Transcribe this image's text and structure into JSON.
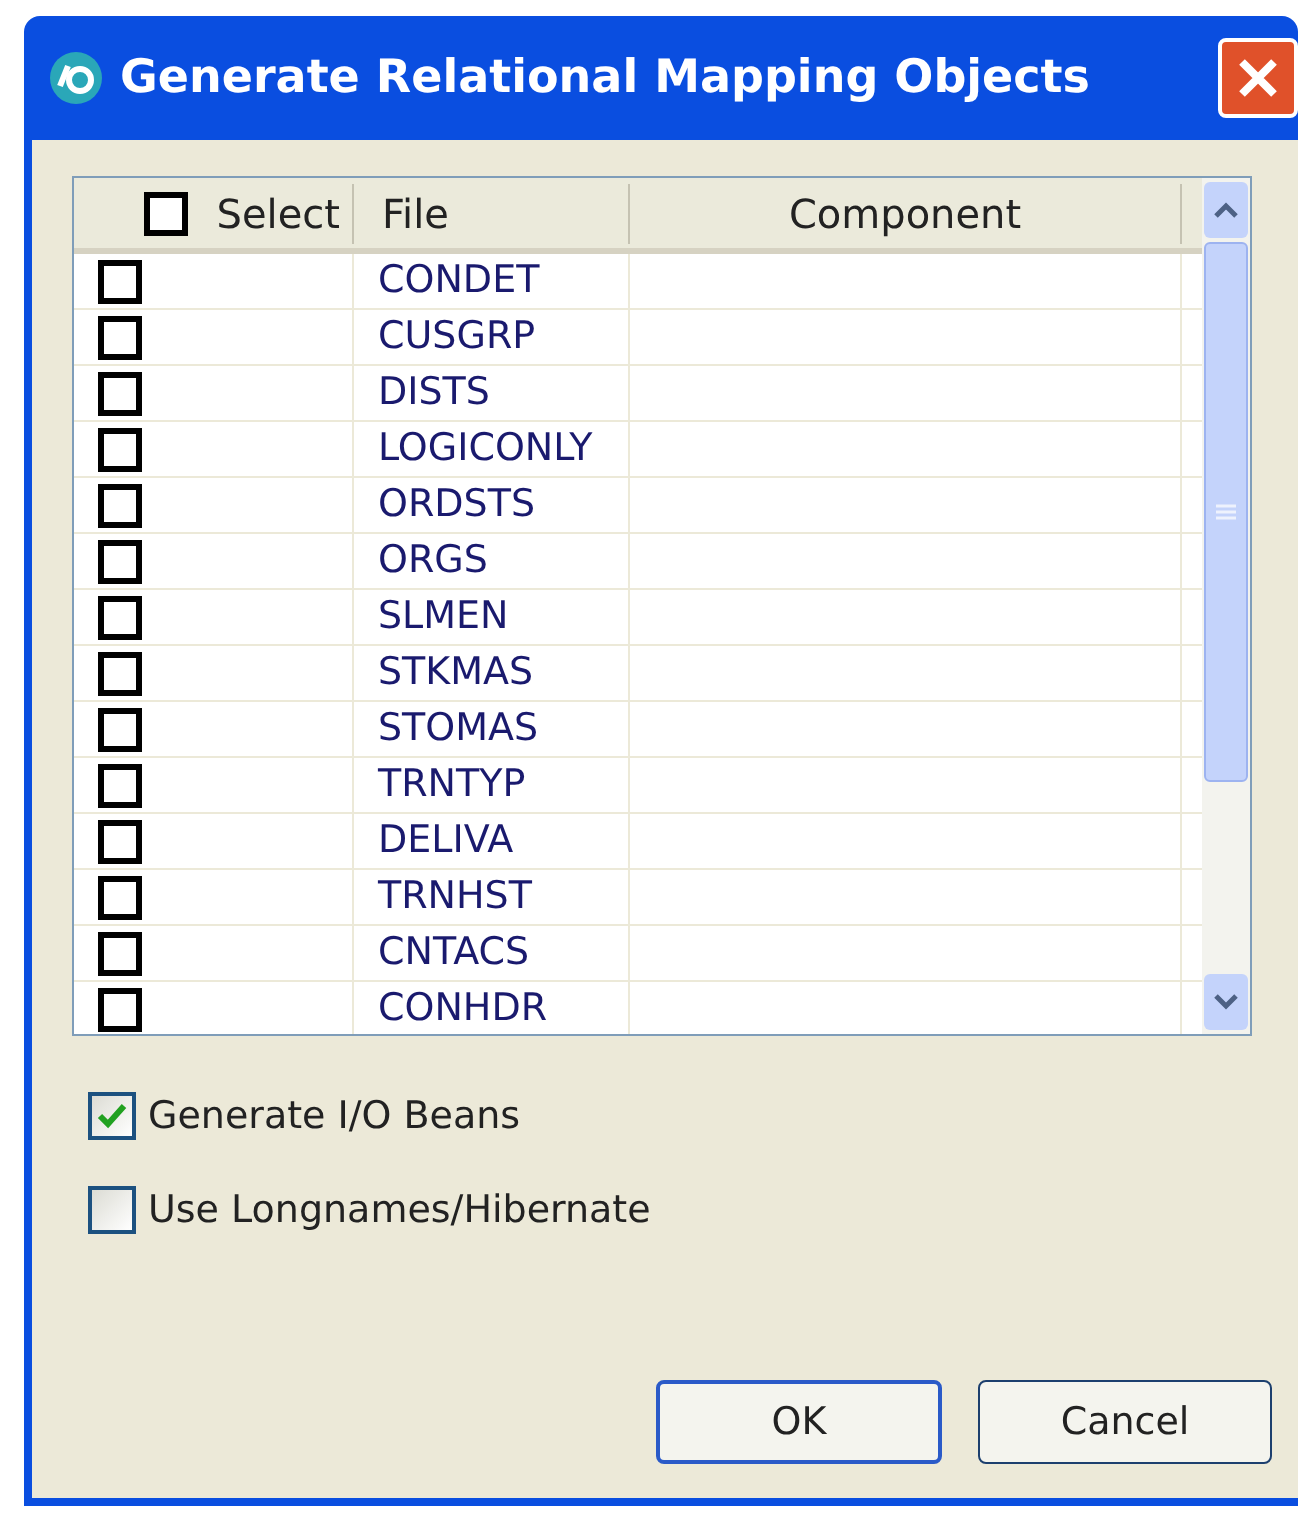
{
  "window": {
    "title": "Generate Relational Mapping Objects"
  },
  "table": {
    "select_all": {
      "checked": false
    },
    "columns": [
      "Select",
      "File",
      "Component"
    ],
    "rows": [
      {
        "checked": false,
        "file": "CONDET"
      },
      {
        "checked": false,
        "file": "CUSGRP"
      },
      {
        "checked": false,
        "file": "DISTS"
      },
      {
        "checked": false,
        "file": "LOGICONLY"
      },
      {
        "checked": false,
        "file": "ORDSTS"
      },
      {
        "checked": false,
        "file": "ORGS"
      },
      {
        "checked": false,
        "file": "SLMEN"
      },
      {
        "checked": false,
        "file": "STKMAS"
      },
      {
        "checked": false,
        "file": "STOMAS"
      },
      {
        "checked": false,
        "file": "TRNTYP"
      },
      {
        "checked": false,
        "file": "DELIVA"
      },
      {
        "checked": false,
        "file": "TRNHST"
      },
      {
        "checked": false,
        "file": "CNTACS"
      },
      {
        "checked": false,
        "file": "CONHDR"
      }
    ]
  },
  "options": [
    {
      "label": "Generate I/O Beans",
      "checked": true
    },
    {
      "label": "Use Longnames/Hibernate",
      "checked": false
    }
  ],
  "buttons": [
    {
      "label": "OK",
      "default": true
    },
    {
      "label": "Cancel",
      "default": false
    }
  ]
}
